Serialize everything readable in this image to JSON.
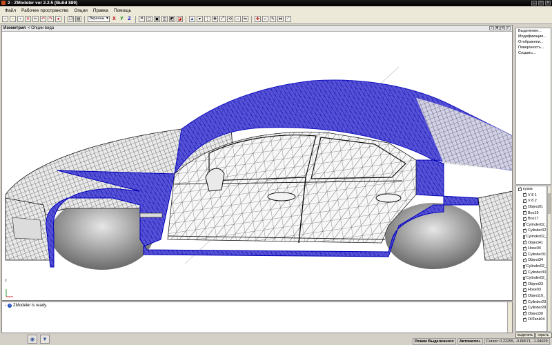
{
  "window": {
    "title": "2 - ZModeler ver 2.2.5 (Build 889)",
    "buttons": [
      "_",
      "□",
      "×"
    ]
  },
  "menu": [
    "Файл",
    "Рабочее пространство",
    "Опции",
    "Правка",
    "Помощь"
  ],
  "toolbar": {
    "view_mode": "Экранны",
    "axes": [
      "X",
      "Y",
      "Z"
    ]
  },
  "viewport": {
    "title": "Изометрия",
    "options_label": "< Опции вида",
    "axis_label": "x"
  },
  "command_panel": {
    "items": [
      "Выделение...",
      "Модификация...",
      "Отображени...",
      "Поверхность...",
      "Создать..."
    ]
  },
  "scene_tree": {
    "items": [
      "кузов",
      "V 8 1",
      "V 8 2",
      "Object01",
      "Box19",
      "Box17",
      "Cylinder02_",
      "Cylinder32",
      "Cylinder02_",
      "Object41",
      "Hose04",
      "Cylinder31",
      "Object34",
      "Cylinder02_",
      "Cylinder30",
      "Cylinder02_",
      "Object33",
      "Hose03",
      "Object10_",
      "Cylinder29",
      "Cylinder28",
      "Object30",
      "OilTank04"
    ]
  },
  "panel_buttons": [
    "выделить",
    "скрыть вс"
  ],
  "log": {
    "message": "ZModeler is ready."
  },
  "status": {
    "mode": "Режим Выделенного",
    "auto": "Автоматич.",
    "cursor": "Cursor: 0.22255, -0.66671, -1.04029"
  },
  "colors": {
    "selection_wire": "#1a1adc",
    "body_wire": "#2a2a2a"
  }
}
